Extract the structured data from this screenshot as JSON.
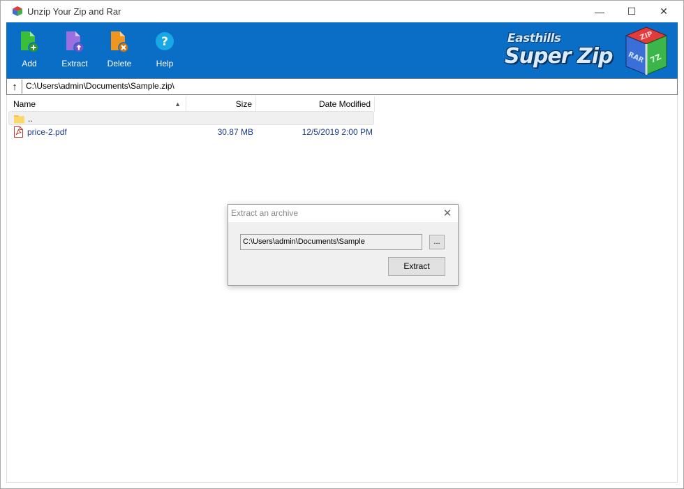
{
  "window": {
    "title": "Unzip Your Zip and Rar"
  },
  "titlebar": {
    "minimize_glyph": "—",
    "maximize_glyph": "☐",
    "close_glyph": "✕"
  },
  "toolbar": {
    "background": "#0a6dc6",
    "add_label": "Add",
    "extract_label": "Extract",
    "delete_label": "Delete",
    "help_label": "Help",
    "add_icon": "add-file-icon",
    "extract_icon": "extract-file-icon",
    "delete_icon": "delete-file-icon",
    "help_icon": "help-icon",
    "add_color": "#3bbf3b",
    "extract_color": "#9b6fe0",
    "delete_color": "#f0961e",
    "help_color": "#17a9e6"
  },
  "brand": {
    "line1": "Easthills",
    "line2": "Super Zip",
    "cube_labels": [
      "ZIP",
      "RAR",
      "7Z"
    ]
  },
  "pathbar": {
    "up_glyph": "↑",
    "path": "C:\\Users\\admin\\Documents\\Sample.zip\\"
  },
  "filelist": {
    "columns": {
      "name": "Name",
      "size": "Size",
      "date": "Date Modified"
    },
    "sort_glyph": "▲",
    "parent": {
      "name": ".."
    },
    "files": [
      {
        "name": "price-2.pdf",
        "size": "30.87 MB",
        "date": "12/5/2019 2:00 PM"
      }
    ]
  },
  "dialog": {
    "title": "Extract an archive",
    "close_glyph": "✕",
    "destination": "C:\\Users\\admin\\Documents\\Sample",
    "browse_label": "...",
    "extract_label": "Extract"
  }
}
